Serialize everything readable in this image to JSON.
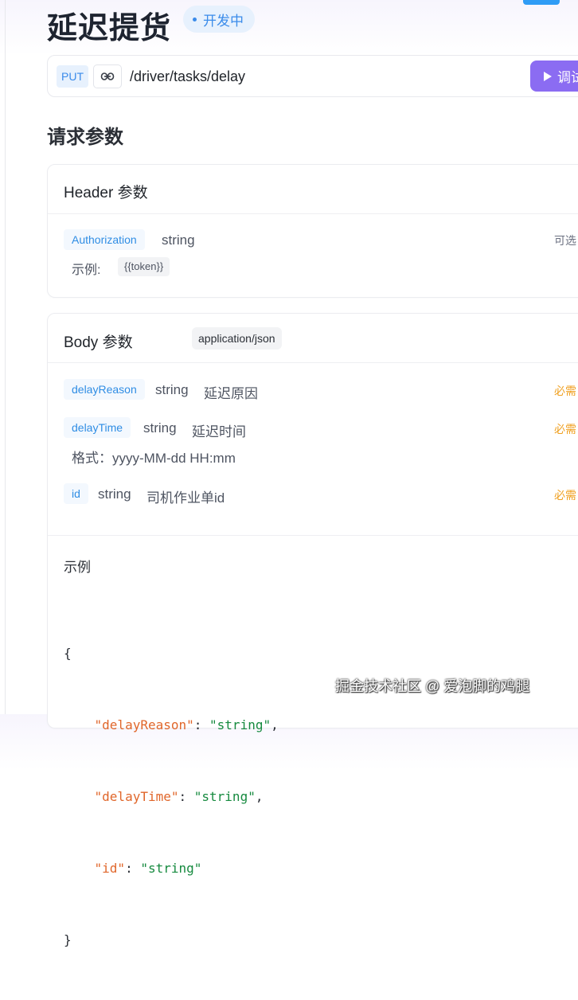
{
  "page": {
    "title": "延迟提货",
    "status": "开发中"
  },
  "endpoint": {
    "method": "PUT",
    "path": "/driver/tasks/delay",
    "run_label": "调试"
  },
  "request_params": {
    "title": "请求参数",
    "header": {
      "title": "Header 参数",
      "params": [
        {
          "name": "Authorization",
          "type": "string",
          "flag": "可选",
          "example_label": "示例:",
          "example_value": "{{token}}"
        }
      ]
    },
    "body": {
      "title": "Body 参数",
      "content_type": "application/json",
      "params": [
        {
          "name": "delayReason",
          "type": "string",
          "description": "延迟原因",
          "flag": "必需"
        },
        {
          "name": "delayTime",
          "type": "string",
          "description": "延迟时间",
          "flag": "必需",
          "format": "格式：yyyy-MM-dd HH:mm"
        },
        {
          "name": "id",
          "type": "string",
          "description": "司机作业单id",
          "flag": "必需"
        }
      ],
      "example": {
        "title": "示例",
        "open_brace": "{",
        "close_brace": "}",
        "fields": [
          {
            "key": "\"delayReason\"",
            "value": "\"string\"",
            "trail": ","
          },
          {
            "key": "\"delayTime\"",
            "value": "\"string\"",
            "trail": ","
          },
          {
            "key": "\"id\"",
            "value": "\"string\"",
            "trail": ""
          }
        ]
      }
    }
  },
  "watermark": "掘金技术社区 @ 爱泡脚的鸡腿",
  "colors": {
    "accent_blue": "#3a8bea",
    "run_button": "#8b6cf2",
    "required": "#f0a020",
    "json_key": "#e0662a",
    "json_string": "#168a3f"
  },
  "icons": {
    "link": "link-icon",
    "run": "play-icon"
  }
}
